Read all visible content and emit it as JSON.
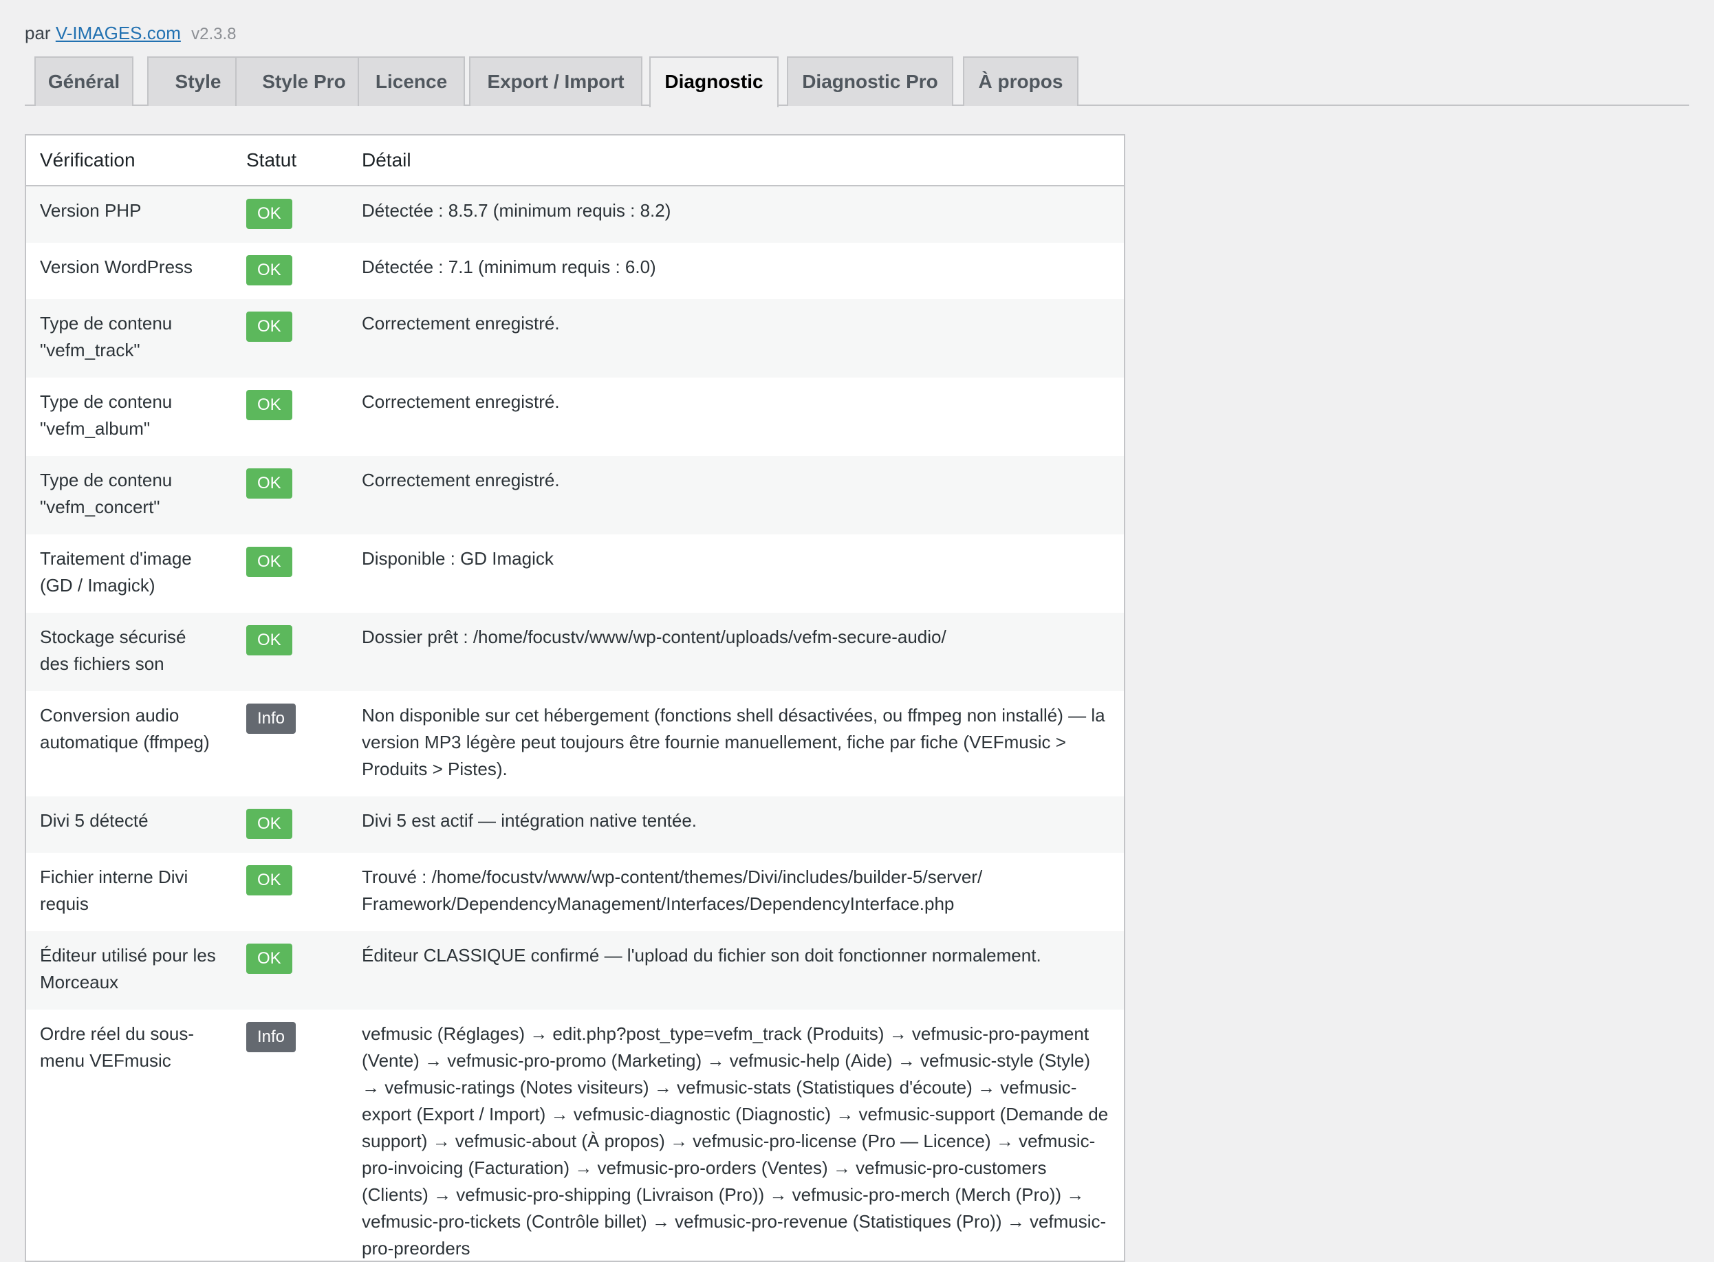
{
  "header": {
    "by_prefix": "par",
    "link_text": "V-IMAGES.com",
    "version": "v2.3.8"
  },
  "tabs": [
    {
      "label": "Général",
      "active": false
    },
    {
      "label": "Style",
      "active": false
    },
    {
      "label": "Style Pro",
      "active": false
    },
    {
      "label": "Licence",
      "active": false
    },
    {
      "label": "Export / Import",
      "active": false
    },
    {
      "label": "Diagnostic",
      "active": true
    },
    {
      "label": "Diagnostic Pro",
      "active": false
    },
    {
      "label": "À propos",
      "active": false
    }
  ],
  "table": {
    "columns": [
      "Vérification",
      "Statut",
      "Détail"
    ],
    "rows": [
      {
        "check": "Version PHP",
        "status": "OK",
        "status_type": "ok",
        "detail": "Détectée : 8.5.7 (minimum requis : 8.2)"
      },
      {
        "check": "Version WordPress",
        "status": "OK",
        "status_type": "ok",
        "detail": "Détectée : 7.1 (minimum requis : 6.0)"
      },
      {
        "check": "Type de contenu \"vefm_track\"",
        "status": "OK",
        "status_type": "ok",
        "detail": "Correctement enregistré."
      },
      {
        "check": "Type de contenu \"vefm_album\"",
        "status": "OK",
        "status_type": "ok",
        "detail": "Correctement enregistré."
      },
      {
        "check": "Type de contenu \"vefm_concert\"",
        "status": "OK",
        "status_type": "ok",
        "detail": "Correctement enregistré."
      },
      {
        "check": "Traitement d'image (GD / Imagick)",
        "status": "OK",
        "status_type": "ok",
        "detail": "Disponible : GD Imagick"
      },
      {
        "check": "Stockage sécurisé des fichiers son",
        "status": "OK",
        "status_type": "ok",
        "detail": "Dossier prêt : /home/focustv/www/wp-content/uploads/vefm-secure-audio/"
      },
      {
        "check": "Conversion audio automatique (ffmpeg)",
        "status": "Info",
        "status_type": "info",
        "detail": "Non disponible sur cet hébergement (fonctions shell désactivées, ou ffmpeg non installé) — la version MP3 légère peut toujours être fournie manuellement, fiche par fiche (VEFmusic > Produits > Pistes)."
      },
      {
        "check": "Divi 5 détecté",
        "status": "OK",
        "status_type": "ok",
        "detail": "Divi 5 est actif — intégration native tentée."
      },
      {
        "check": "Fichier interne Divi requis",
        "status": "OK",
        "status_type": "ok",
        "detail": "Trouvé : /home/focustv/www/wp-content/themes/Divi/includes/builder-5/server/ Framework/DependencyManagement/Interfaces/DependencyInterface.php"
      },
      {
        "check": "Éditeur utilisé pour les Morceaux",
        "status": "OK",
        "status_type": "ok",
        "detail": "Éditeur CLASSIQUE confirmé — l'upload du fichier son doit fonctionner normalement."
      },
      {
        "check": "Ordre réel du sous-menu VEFmusic",
        "status": "Info",
        "status_type": "info",
        "detail": "vefmusic (Réglages) → edit.php?post_type=vefm_track (Produits) → vefmusic-pro-payment (Vente) → vefmusic-pro-promo (Marketing) → vefmusic-help (Aide) → vefmusic-style (Style) → vefmusic-ratings (Notes visiteurs) → vefmusic-stats (Statistiques d'écoute) → vefmusic-export (Export / Import) → vefmusic-diagnostic (Diagnostic) → vefmusic-support (Demande de support) → vefmusic-about (À propos) → vefmusic-pro-license (Pro — Licence) → vefmusic-pro-invoicing (Facturation) → vefmusic-pro-orders (Ventes) → vefmusic-pro-customers (Clients) → vefmusic-pro-shipping (Livraison (Pro)) → vefmusic-pro-merch (Merch (Pro)) → vefmusic-pro-tickets (Contrôle billet) → vefmusic-pro-revenue (Statistiques (Pro)) → vefmusic-pro-preorders"
      }
    ]
  }
}
